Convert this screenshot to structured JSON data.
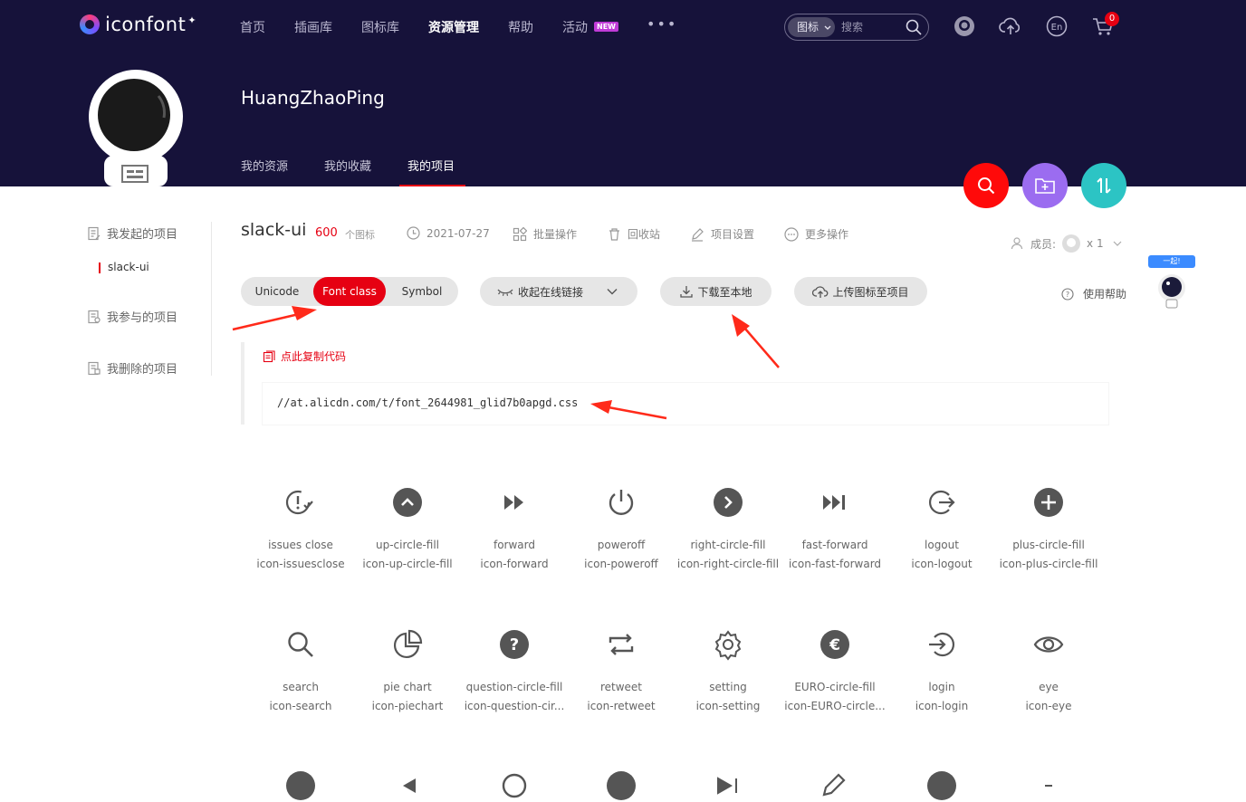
{
  "brand": {
    "logo_text": "iconfont"
  },
  "nav": {
    "items": [
      "首页",
      "插画库",
      "图标库",
      "资源管理",
      "帮助",
      "活动"
    ],
    "active": "资源管理",
    "new_badge": "NEW",
    "more": "•••"
  },
  "search": {
    "type_label": "图标",
    "placeholder": "搜索"
  },
  "cart": {
    "count": "0"
  },
  "profile": {
    "username": "HuangZhaoPing",
    "tabs": [
      "我的资源",
      "我的收藏",
      "我的项目"
    ],
    "active_tab": "我的项目"
  },
  "fab_colors": {
    "search": "#ff0a0a",
    "folder": "#9b6cf0",
    "sort": "#2cc4c4"
  },
  "sidebar": {
    "initiated": "我发起的项目",
    "current_project": "slack-ui",
    "participated": "我参与的项目",
    "deleted": "我删除的项目"
  },
  "project": {
    "name": "slack-ui",
    "count": "600",
    "count_unit": "个图标",
    "date": "2021-07-27",
    "batch": "批量操作",
    "recycle": "回收站",
    "settings": "项目设置",
    "more": "更多操作",
    "members_label": "成员:",
    "members_count": "x 1"
  },
  "modes": {
    "unicode": "Unicode",
    "font_class": "Font class",
    "symbol": "Symbol",
    "active": "Font class"
  },
  "actions": {
    "collapse_link": "收起在线链接",
    "download": "下载至本地",
    "upload": "上传图标至项目",
    "help": "使用帮助"
  },
  "code": {
    "copy_label": "点此复制代码",
    "url": "//at.alicdn.com/t/font_2644981_glid7b0apgd.css"
  },
  "robot": {
    "tag": "一起!"
  },
  "icons": [
    {
      "name": "issues close",
      "cls": "icon-issuesclose",
      "glyph": "issues-close-icon"
    },
    {
      "name": "up-circle-fill",
      "cls": "icon-up-circle-fill",
      "glyph": "up-circle-fill-icon"
    },
    {
      "name": "forward",
      "cls": "icon-forward",
      "glyph": "forward-icon"
    },
    {
      "name": "poweroff",
      "cls": "icon-poweroff",
      "glyph": "poweroff-icon"
    },
    {
      "name": "right-circle-fill",
      "cls": "icon-right-circle-fill",
      "glyph": "right-circle-fill-icon"
    },
    {
      "name": "fast-forward",
      "cls": "icon-fast-forward",
      "glyph": "fast-forward-icon"
    },
    {
      "name": "logout",
      "cls": "icon-logout",
      "glyph": "logout-icon"
    },
    {
      "name": "plus-circle-fill",
      "cls": "icon-plus-circle-fill",
      "glyph": "plus-circle-fill-icon"
    },
    {
      "name": "search",
      "cls": "icon-search",
      "glyph": "search-icon"
    },
    {
      "name": "pie chart",
      "cls": "icon-piechart",
      "glyph": "piechart-icon"
    },
    {
      "name": "question-circle-fill",
      "cls": "icon-question-cir...",
      "glyph": "question-circle-fill-icon"
    },
    {
      "name": "retweet",
      "cls": "icon-retweet",
      "glyph": "retweet-icon"
    },
    {
      "name": "setting",
      "cls": "icon-setting",
      "glyph": "setting-icon"
    },
    {
      "name": "EURO-circle-fill",
      "cls": "icon-EURO-circle...",
      "glyph": "euro-circle-fill-icon"
    },
    {
      "name": "login",
      "cls": "icon-login",
      "glyph": "login-icon"
    },
    {
      "name": "eye",
      "cls": "icon-eye",
      "glyph": "eye-icon"
    }
  ]
}
